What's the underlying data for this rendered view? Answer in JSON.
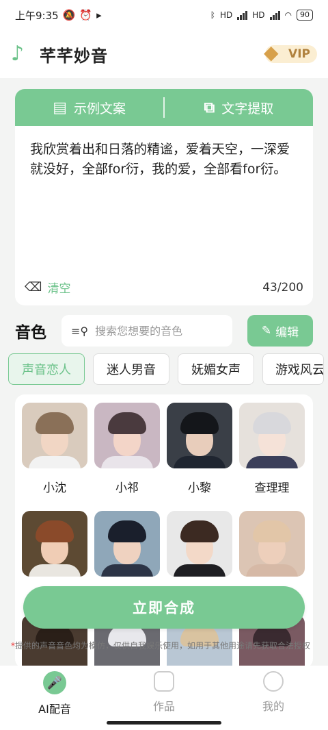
{
  "status_bar": {
    "time": "上午9:35",
    "network_1": "HD",
    "network_2": "HD",
    "battery": "90"
  },
  "header": {
    "app_name": "芊芊妙音",
    "vip_label": "VIP"
  },
  "text_card": {
    "tab_example": "示例文案",
    "tab_extract": "文字提取",
    "content": "我欣赏着出和日落的精谧，爱着天空，一深爱就没好，全部for衍，我的爱，全部看for衍。",
    "clear_label": "清空",
    "char_count": "43/200"
  },
  "voice_section": {
    "title": "音色",
    "search_placeholder": "搜索您想要的音色",
    "edit_label": "编辑"
  },
  "categories": [
    {
      "label": "声音恋人",
      "active": true
    },
    {
      "label": "迷人男音",
      "active": false
    },
    {
      "label": "妩媚女声",
      "active": false
    },
    {
      "label": "游戏风云",
      "active": false
    }
  ],
  "voices": [
    {
      "name": "小沈"
    },
    {
      "name": "小祁"
    },
    {
      "name": "小黎"
    },
    {
      "name": "查理理"
    }
  ],
  "synth_button": "立即合成",
  "disclaimer": {
    "star": "*",
    "text": "提供的声音音色均为模仿，仅供自我娱乐使用，如用于其他用途请先获取合法授权"
  },
  "bottom_nav": [
    {
      "label": "AI配音",
      "active": true
    },
    {
      "label": "作品",
      "active": false
    },
    {
      "label": "我的",
      "active": false
    }
  ],
  "colors": {
    "accent": "#79c993",
    "accent_text": "#6cc28a",
    "vip_gold": "#b0813d"
  }
}
